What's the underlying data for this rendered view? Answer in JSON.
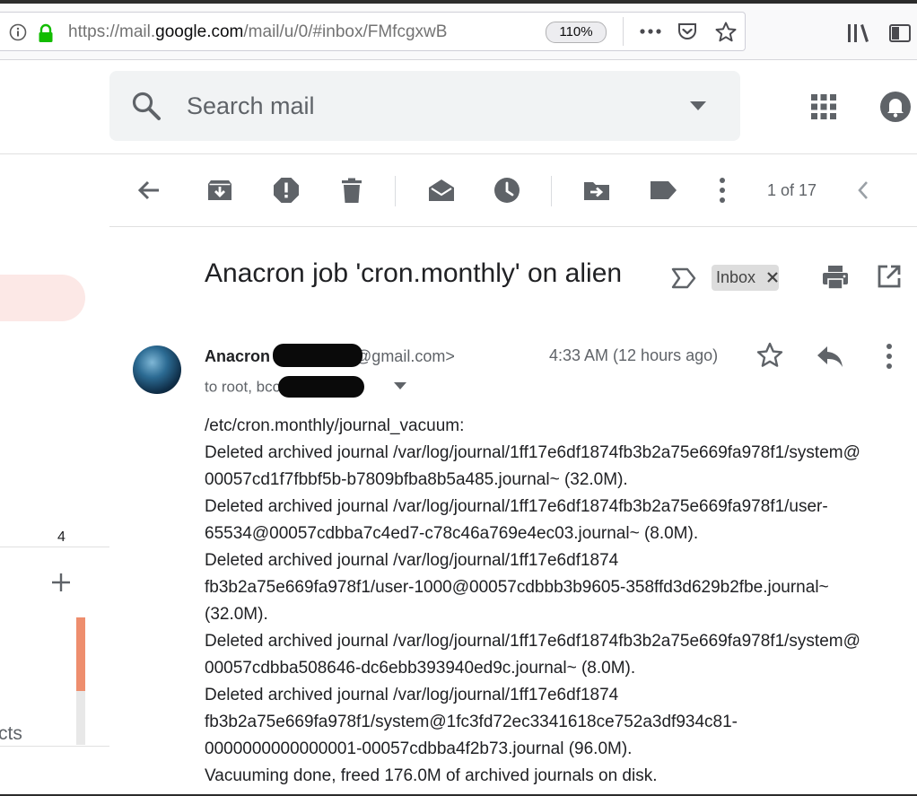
{
  "browser": {
    "url_prefix": "https://mail.",
    "url_domain": "google.com",
    "url_path": "/mail/u/0/#inbox/FMfcgxwB",
    "zoom": "110%"
  },
  "search": {
    "placeholder": "Search mail"
  },
  "sidebar": {
    "count": "4",
    "partial_label": "cts"
  },
  "toolbar": {
    "pager": "1 of 17"
  },
  "message": {
    "subject": "Anacron job 'cron.monthly' on alien",
    "label": "Inbox",
    "sender_name": "Anacron",
    "sender_email_tail": "@gmail.com>",
    "recipients": "to root, bcc",
    "timestamp": "4:33 AM (12 hours ago)",
    "body_lines": [
      "/etc/cron.monthly/journal_vacuum:",
      "Deleted archived journal /var/log/journal/1ff17e6df1874fb3b2a75e669fa978f1/system@",
      "00057cd1f7fbbf5b-b7809bfba8b5a485.journal~ (32.0M).",
      "Deleted archived journal /var/log/journal/1ff17e6df1874fb3b2a75e669fa978f1/user-",
      "65534@00057cdbba7c4ed7-c78c46a769e4ec03.journal~ (8.0M).",
      "Deleted archived journal /var/log/journal/1ff17e6df1874",
      "fb3b2a75e669fa978f1/user-1000@00057cdbbb3b9605-358ffd3d629b2fbe.journal~",
      "(32.0M).",
      "Deleted archived journal /var/log/journal/1ff17e6df1874fb3b2a75e669fa978f1/system@",
      "00057cdbba508646-dc6ebb393940ed9c.journal~ (8.0M).",
      "Deleted archived journal /var/log/journal/1ff17e6df1874",
      "fb3b2a75e669fa978f1/system@1fc3fd72ec3341618ce752a3df934c81-",
      "0000000000000001-00057cdbba4f2b73.journal (96.0M).",
      "Vacuuming done, freed 176.0M of archived journals on disk."
    ]
  },
  "colors": {
    "accent_pill": "#fce8e6",
    "scroll_thumb": "#ee8e6e",
    "lock_green": "#12bc00"
  },
  "icons": [
    "info-icon",
    "lock-icon",
    "ellipsis-icon",
    "pocket-icon",
    "bookmark-star-icon",
    "library-icon",
    "sidebar-toggle-icon",
    "search-icon",
    "chevron-down-icon",
    "apps-grid-icon",
    "account-icon",
    "back-arrow-icon",
    "archive-icon",
    "report-spam-icon",
    "delete-icon",
    "mark-unread-icon",
    "snooze-icon",
    "move-to-icon",
    "label-icon",
    "more-vert-icon",
    "prev-chevron-icon",
    "importance-marker-icon",
    "close-icon",
    "print-icon",
    "open-new-window-icon",
    "star-icon",
    "reply-icon",
    "plus-icon"
  ]
}
